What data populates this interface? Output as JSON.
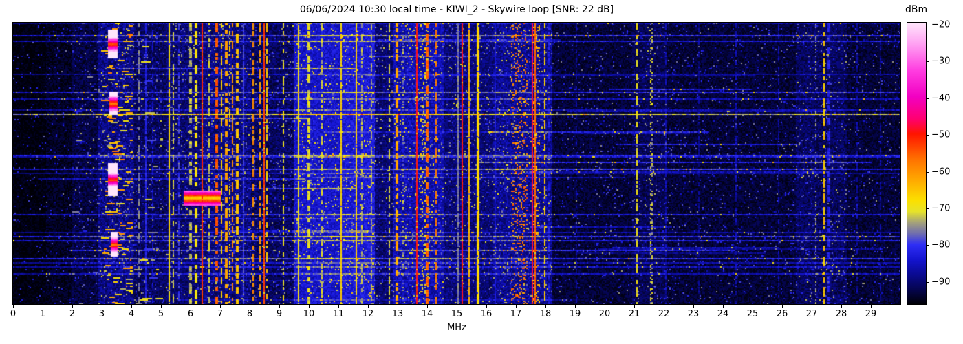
{
  "title": "06/06/2024 10:30 local time - KIWI_2 - Skywire loop [SNR: 22 dB]",
  "x_axis": {
    "label": "MHz",
    "ticks": [
      0,
      1,
      2,
      3,
      4,
      5,
      6,
      7,
      8,
      9,
      10,
      11,
      12,
      13,
      14,
      15,
      16,
      17,
      18,
      19,
      20,
      21,
      22,
      23,
      24,
      25,
      26,
      27,
      28,
      29
    ],
    "min": 0,
    "max": 30
  },
  "colorbar": {
    "label": "dBm",
    "ticks": [
      {
        "v": -20,
        "label": "−20"
      },
      {
        "v": -30,
        "label": "−30"
      },
      {
        "v": -40,
        "label": "−40"
      },
      {
        "v": -50,
        "label": "−50"
      },
      {
        "v": -60,
        "label": "−60"
      },
      {
        "v": -70,
        "label": "−70"
      },
      {
        "v": -80,
        "label": "−80"
      },
      {
        "v": -90,
        "label": "−90"
      }
    ],
    "vmax": -19.5,
    "vmin": -96
  },
  "chart_data": {
    "type": "heatmap",
    "subtype": "radio-spectrogram-waterfall",
    "title": "06/06/2024 10:30 local time - KIWI_2 - Skywire loop [SNR: 22 dB]",
    "xlabel": "MHz",
    "x_range": [
      0,
      30
    ],
    "x_ticks": [
      0,
      1,
      2,
      3,
      4,
      5,
      6,
      7,
      8,
      9,
      10,
      11,
      12,
      13,
      14,
      15,
      16,
      17,
      18,
      19,
      20,
      21,
      22,
      23,
      24,
      25,
      26,
      27,
      28,
      29
    ],
    "value_label": "dBm",
    "value_range_dbm": [
      -96,
      -20
    ],
    "colorbar_ticks_dbm": [
      -20,
      -30,
      -40,
      -50,
      -60,
      -70,
      -80,
      -90
    ],
    "legend_position": "right-colorbar",
    "grid": false,
    "colormap_stops": [
      {
        "v": -20,
        "c": "#ffe6fb"
      },
      {
        "v": -26,
        "c": "#ff9ef2"
      },
      {
        "v": -33,
        "c": "#ff3ce0"
      },
      {
        "v": -40,
        "c": "#f200c2"
      },
      {
        "v": -46,
        "c": "#ff0070"
      },
      {
        "v": -50,
        "c": "#ff1400"
      },
      {
        "v": -57,
        "c": "#ff7300"
      },
      {
        "v": -63,
        "c": "#ffae00"
      },
      {
        "v": -68,
        "c": "#fbe000"
      },
      {
        "v": -71,
        "c": "#e6e32a"
      },
      {
        "v": -74,
        "c": "#a3a07c"
      },
      {
        "v": -77,
        "c": "#6e6cb0"
      },
      {
        "v": -80,
        "c": "#2e2ef5"
      },
      {
        "v": -84,
        "c": "#1414cf"
      },
      {
        "v": -88,
        "c": "#0a0a90"
      },
      {
        "v": -92,
        "c": "#050550"
      },
      {
        "v": -96,
        "c": "#000005"
      }
    ],
    "noise_regions": [
      {
        "f0": 0.0,
        "f1": 1.1,
        "base": -96,
        "amp": 3
      },
      {
        "f0": 1.1,
        "f1": 2.0,
        "base": -95,
        "amp": 4
      },
      {
        "f0": 2.0,
        "f1": 2.9,
        "base": -93.5,
        "amp": 5
      },
      {
        "f0": 2.9,
        "f1": 4.1,
        "base": -90,
        "amp": 7
      },
      {
        "f0": 4.1,
        "f1": 5.15,
        "base": -92,
        "amp": 6
      },
      {
        "f0": 5.15,
        "f1": 6.4,
        "base": -91,
        "amp": 6
      },
      {
        "f0": 6.4,
        "f1": 8.05,
        "base": -90,
        "amp": 7
      },
      {
        "f0": 8.05,
        "f1": 9.5,
        "base": -92,
        "amp": 6
      },
      {
        "f0": 9.5,
        "f1": 11.15,
        "base": -85,
        "amp": 6
      },
      {
        "f0": 11.15,
        "f1": 12.25,
        "base": -84,
        "amp": 6
      },
      {
        "f0": 12.25,
        "f1": 12.85,
        "base": -91,
        "amp": 6
      },
      {
        "f0": 12.85,
        "f1": 14.55,
        "base": -87,
        "amp": 7
      },
      {
        "f0": 14.55,
        "f1": 16.25,
        "base": -90.5,
        "amp": 6
      },
      {
        "f0": 16.25,
        "f1": 18.25,
        "base": -89,
        "amp": 7
      },
      {
        "f0": 18.25,
        "f1": 20.95,
        "base": -94,
        "amp": 4.5
      },
      {
        "f0": 20.95,
        "f1": 22.1,
        "base": -92.5,
        "amp": 5
      },
      {
        "f0": 22.1,
        "f1": 26.45,
        "base": -94,
        "amp": 4.5
      },
      {
        "f0": 26.45,
        "f1": 28.2,
        "base": -92,
        "amp": 6
      },
      {
        "f0": 28.2,
        "f1": 30.0,
        "base": -94,
        "amp": 4.5
      }
    ],
    "hdash_regions": [
      {
        "f0": 3.0,
        "f1": 4.05,
        "prob": 0.55,
        "lmin": -74,
        "lmax": -56
      },
      {
        "f0": 4.1,
        "f1": 5.1,
        "prob": 0.12,
        "lmin": -80,
        "lmax": -68
      },
      {
        "f0": 2.0,
        "f1": 2.95,
        "prob": 0.1,
        "lmin": -84,
        "lmax": -74
      }
    ],
    "blobs": [
      {
        "f": 3.38,
        "w": 0.25,
        "y": 0.075,
        "h": 0.012,
        "l": -58
      },
      {
        "f": 3.4,
        "w": 0.2,
        "y": 0.285,
        "h": 0.01,
        "l": -62
      },
      {
        "f": 3.36,
        "w": 0.28,
        "y": 0.555,
        "h": 0.014,
        "l": -56
      },
      {
        "f": 3.42,
        "w": 0.2,
        "y": 0.785,
        "h": 0.01,
        "l": -60
      },
      {
        "f": 6.4,
        "w": 1.2,
        "y": 0.62,
        "h": 0.006,
        "l": -68
      }
    ],
    "signal_bands": [
      {
        "f": 4.25,
        "w": 0.05,
        "l": -76,
        "s": "dash"
      },
      {
        "f": 4.47,
        "w": 0.04,
        "l": -82,
        "s": "solid"
      },
      {
        "f": 4.72,
        "w": 0.04,
        "l": -84,
        "s": "dash"
      },
      {
        "f": 5.29,
        "w": 0.06,
        "l": -68,
        "s": "solid"
      },
      {
        "f": 5.4,
        "w": 0.05,
        "l": -72,
        "s": "dash"
      },
      {
        "f": 5.62,
        "w": 0.04,
        "l": -80,
        "s": "dash"
      },
      {
        "f": 6.0,
        "w": 0.05,
        "l": -73,
        "s": "dash"
      },
      {
        "f": 6.18,
        "w": 0.06,
        "l": -69,
        "s": "dash"
      },
      {
        "f": 6.38,
        "w": 0.05,
        "l": -52,
        "s": "solid"
      },
      {
        "f": 6.63,
        "w": 0.05,
        "l": -72,
        "s": "dash"
      },
      {
        "f": 6.89,
        "w": 0.06,
        "l": -55,
        "s": "dash"
      },
      {
        "f": 7.06,
        "w": 0.05,
        "l": -66,
        "s": "dash"
      },
      {
        "f": 7.21,
        "w": 0.06,
        "l": -62,
        "s": "dash"
      },
      {
        "f": 7.33,
        "w": 0.05,
        "l": -68,
        "s": "speck"
      },
      {
        "f": 7.44,
        "w": 0.05,
        "l": -60,
        "s": "dash"
      },
      {
        "f": 7.58,
        "w": 0.05,
        "l": -65,
        "s": "dash"
      },
      {
        "f": 7.79,
        "w": 0.06,
        "l": -80,
        "s": "solid"
      },
      {
        "f": 8.12,
        "w": 0.06,
        "l": -60,
        "s": "dash"
      },
      {
        "f": 8.33,
        "w": 0.05,
        "l": -62,
        "s": "dash"
      },
      {
        "f": 8.49,
        "w": 0.07,
        "l": -53,
        "s": "solid"
      },
      {
        "f": 8.6,
        "w": 0.04,
        "l": -66,
        "s": "dash"
      },
      {
        "f": 9.14,
        "w": 0.05,
        "l": -70,
        "s": "dash"
      },
      {
        "f": 9.65,
        "w": 0.05,
        "l": -69,
        "s": "solid"
      },
      {
        "f": 10.0,
        "w": 0.05,
        "l": -71,
        "s": "dash"
      },
      {
        "f": 10.45,
        "w": 0.05,
        "l": -72,
        "s": "dash"
      },
      {
        "f": 11.1,
        "w": 0.06,
        "l": -67,
        "s": "solid"
      },
      {
        "f": 11.62,
        "w": 0.06,
        "l": -66,
        "s": "solid"
      },
      {
        "f": 11.78,
        "w": 0.04,
        "l": -73,
        "s": "dash"
      },
      {
        "f": 12.1,
        "w": 0.04,
        "l": -74,
        "s": "dash"
      },
      {
        "f": 12.7,
        "w": 0.05,
        "l": -72,
        "s": "dash"
      },
      {
        "f": 12.97,
        "w": 0.06,
        "l": -62,
        "s": "dash"
      },
      {
        "f": 13.2,
        "w": 0.04,
        "l": -75,
        "s": "speck"
      },
      {
        "f": 13.66,
        "w": 0.06,
        "l": -50,
        "s": "solid"
      },
      {
        "f": 13.9,
        "w": 0.3,
        "l": -70,
        "s": "speck"
      },
      {
        "f": 14.0,
        "w": 0.05,
        "l": -56,
        "s": "dash"
      },
      {
        "f": 14.3,
        "w": 0.06,
        "l": -58,
        "s": "dash"
      },
      {
        "f": 15.02,
        "w": 0.04,
        "l": -76,
        "s": "solid"
      },
      {
        "f": 15.2,
        "w": 0.05,
        "l": -50,
        "s": "solid"
      },
      {
        "f": 15.4,
        "w": 0.05,
        "l": -64,
        "s": "solid"
      },
      {
        "f": 15.72,
        "w": 0.05,
        "l": -67,
        "s": "solid"
      },
      {
        "f": 16.3,
        "w": 0.04,
        "l": -84,
        "s": "solid"
      },
      {
        "f": 17.1,
        "w": 0.55,
        "l": -58,
        "s": "speck"
      },
      {
        "f": 17.56,
        "w": 0.05,
        "l": -48,
        "s": "solid"
      },
      {
        "f": 17.7,
        "w": 0.22,
        "l": -64,
        "s": "speck"
      },
      {
        "f": 17.65,
        "w": 0.06,
        "l": -56,
        "s": "solid"
      },
      {
        "f": 17.98,
        "w": 0.05,
        "l": -66,
        "s": "dash"
      },
      {
        "f": 18.1,
        "w": 0.04,
        "l": -82,
        "s": "dash"
      },
      {
        "f": 19.05,
        "w": 0.04,
        "l": -88,
        "s": "dash"
      },
      {
        "f": 21.08,
        "w": 0.05,
        "l": -70,
        "s": "dash"
      },
      {
        "f": 21.58,
        "w": 0.05,
        "l": -73,
        "s": "speck"
      },
      {
        "f": 22.05,
        "w": 0.04,
        "l": -86,
        "s": "dash"
      },
      {
        "f": 23.2,
        "w": 0.04,
        "l": -88,
        "s": "dash"
      },
      {
        "f": 24.45,
        "w": 0.04,
        "l": -86,
        "s": "dash"
      },
      {
        "f": 25.9,
        "w": 0.04,
        "l": -87,
        "s": "dash"
      },
      {
        "f": 27.12,
        "w": 0.05,
        "l": -76,
        "s": "speck"
      },
      {
        "f": 27.42,
        "w": 0.06,
        "l": -66,
        "s": "dash"
      },
      {
        "f": 27.58,
        "w": 0.05,
        "l": -82,
        "s": "dash"
      },
      {
        "f": 28.55,
        "w": 0.04,
        "l": -87,
        "s": "dash"
      },
      {
        "f": 29.3,
        "w": 0.04,
        "l": -87,
        "s": "dash"
      }
    ],
    "streaks": {
      "count": 48,
      "full_prob": 0.62,
      "boost_min": 4,
      "boost_max": 12
    },
    "render_seed": 1337
  }
}
